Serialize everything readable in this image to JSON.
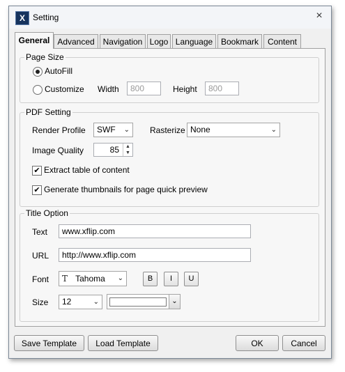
{
  "window": {
    "title": "Setting",
    "app_icon_letter": "X",
    "close_glyph": "×"
  },
  "tabs": [
    "General",
    "Advanced",
    "Navigation",
    "Logo",
    "Language",
    "Bookmark",
    "Content"
  ],
  "page_size": {
    "title": "Page Size",
    "autofill_label": "AutoFill",
    "customize_label": "Customize",
    "width_label": "Width",
    "width_value": "800",
    "height_label": "Height",
    "height_value": "800",
    "selected": "AutoFill"
  },
  "pdf_setting": {
    "title": "PDF Setting",
    "render_profile_label": "Render Profile",
    "render_profile_value": "SWF",
    "rasterize_label": "Rasterize",
    "rasterize_value": "None",
    "image_quality_label": "Image Quality",
    "image_quality_value": "85",
    "extract_toc_label": "Extract table of content",
    "extract_toc_checked": true,
    "thumbnails_label": "Generate thumbnails for page quick preview",
    "thumbnails_checked": true
  },
  "title_option": {
    "title": "Title Option",
    "text_label": "Text",
    "text_value": "www.xflip.com",
    "url_label": "URL",
    "url_value": "http://www.xflip.com",
    "font_label": "Font",
    "font_icon": "T",
    "font_value": "Tahoma",
    "bold_label": "B",
    "italic_label": "I",
    "underline_label": "U",
    "size_label": "Size",
    "size_value": "12",
    "color_value": "#ffffff"
  },
  "footer": {
    "save_template": "Save  Template",
    "load_template": "Load  Template",
    "ok": "OK",
    "cancel": "Cancel"
  }
}
